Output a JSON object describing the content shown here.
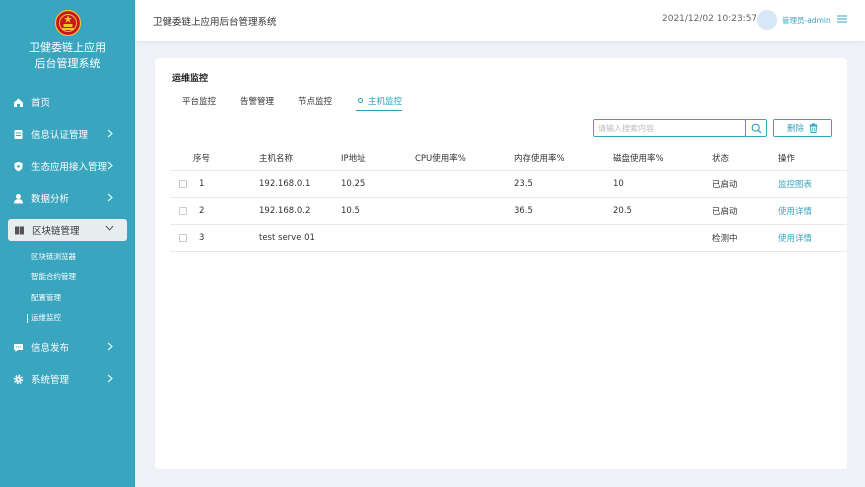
{
  "sidebar": {
    "title_line1": "卫健委链上应用",
    "title_line2": "后台管理系统",
    "items": [
      {
        "label": "首页"
      },
      {
        "label": "信息认证管理"
      },
      {
        "label": "生态应用接入管理"
      },
      {
        "label": "数据分析"
      },
      {
        "label": "区块链管理"
      },
      {
        "label": "信息发布"
      },
      {
        "label": "系统管理"
      }
    ],
    "blockchain_sub": [
      {
        "label": "区块链浏览器"
      },
      {
        "label": "智能合约管理"
      },
      {
        "label": "配置管理"
      },
      {
        "label": "运维监控"
      }
    ]
  },
  "header": {
    "title": "卫健委链上应用后台管理系统",
    "datetime": "2021/12/02 10:23:57",
    "user": "管理员-admin"
  },
  "main": {
    "title": "运维监控",
    "tabs": [
      {
        "label": "平台监控"
      },
      {
        "label": "告警管理"
      },
      {
        "label": "节点监控"
      },
      {
        "label": "主机监控"
      }
    ],
    "search": {
      "placeholder": "请输入搜索内容",
      "value": ""
    },
    "delete_label": "删除",
    "table": {
      "headers": [
        "序号",
        "主机名称",
        "IP地址",
        "CPU使用率%",
        "内存使用率%",
        "磁盘使用率%",
        "状态",
        "操作"
      ],
      "rows": [
        {
          "idx": "1",
          "name": "192.168.0.1",
          "ip": "10.25",
          "cpu": "",
          "mem": "23.5",
          "disk": "10",
          "status": "已启动",
          "op": "监控图表"
        },
        {
          "idx": "2",
          "name": "192.168.0.2",
          "ip": "10.5",
          "cpu": "",
          "mem": "36.5",
          "disk": "20.5",
          "status": "已启动",
          "op": "使用详情"
        },
        {
          "idx": "3",
          "name": "test serve 01",
          "ip": "",
          "cpu": "",
          "mem": "",
          "disk": "",
          "status": "检测中",
          "op": "使用详情"
        }
      ]
    }
  },
  "colors": {
    "accent": "#3aa5bf",
    "sidebar_bg": "#3aa5bf",
    "page_bg": "#eef2f6"
  }
}
